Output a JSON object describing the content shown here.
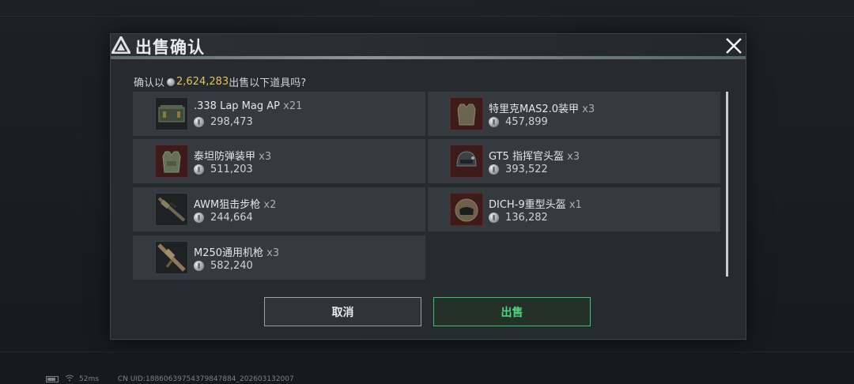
{
  "dialog": {
    "title": "出售确认",
    "prompt_prefix": "确认以",
    "total_amount": "2,624,283",
    "prompt_suffix": "出售以下道具吗?",
    "accent_color": "#e8c25a"
  },
  "items": [
    {
      "name": ".338 Lap Mag AP",
      "qty": "x21",
      "price": "298,473",
      "icon": "ammo-box-icon"
    },
    {
      "name": "特里克MAS2.0装甲",
      "qty": "x3",
      "price": "457,899",
      "icon": "body-armor-icon"
    },
    {
      "name": "泰坦防弹装甲",
      "qty": "x3",
      "price": "511,203",
      "icon": "body-armor-icon"
    },
    {
      "name": "GT5 指挥官头盔",
      "qty": "x3",
      "price": "393,522",
      "icon": "helmet-icon"
    },
    {
      "name": "AWM狙击步枪",
      "qty": "x2",
      "price": "244,664",
      "icon": "sniper-rifle-icon"
    },
    {
      "name": "DICH-9重型头盔",
      "qty": "x1",
      "price": "136,282",
      "icon": "heavy-helmet-icon"
    },
    {
      "name": "M250通用机枪",
      "qty": "x3",
      "price": "582,240",
      "icon": "machine-gun-icon"
    }
  ],
  "buttons": {
    "cancel_label": "取消",
    "sell_label": "出售",
    "sell_color": "#3fbf6c"
  },
  "status_bar": {
    "ping": "52ms",
    "uid": "CN UID:188606397543798478​84_202603132007"
  }
}
